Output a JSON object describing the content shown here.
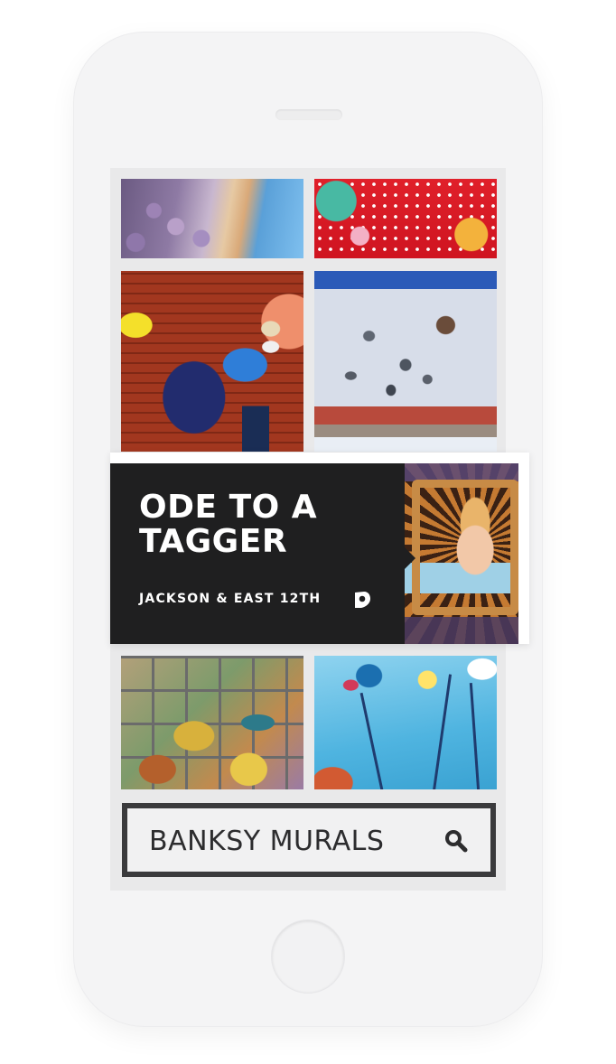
{
  "feature": {
    "title": "ODE TO A TAGGER",
    "location": "JACKSON & EAST 12TH",
    "icon": "location-pin-icon"
  },
  "search": {
    "value": "BANKSY MURALS",
    "icon": "search-icon"
  },
  "colors": {
    "feature_background": "#1f1f20",
    "search_border": "#3a3a3c",
    "screen_background": "#e9e9ea",
    "phone_body": "#f4f4f5"
  }
}
